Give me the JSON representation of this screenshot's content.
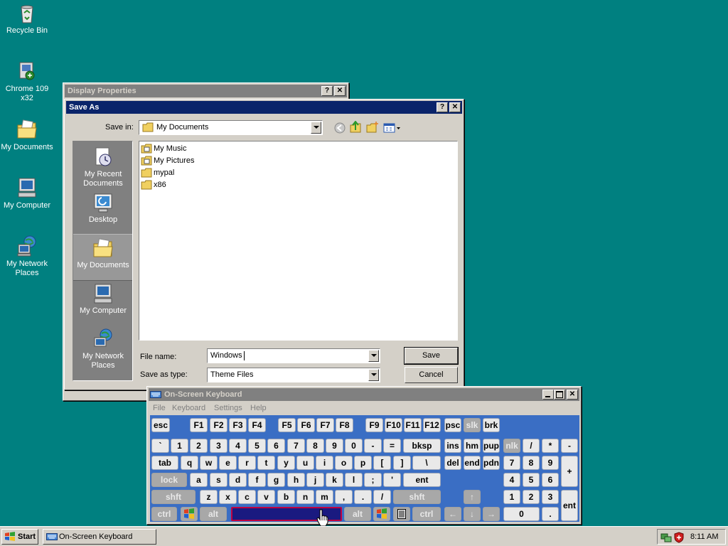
{
  "desktop": {
    "icons": [
      {
        "label": "Recycle Bin",
        "icon": "recycle-bin-icon"
      },
      {
        "label": "Chrome 109 x32",
        "icon": "chrome-setup-icon"
      },
      {
        "label": "My Documents",
        "icon": "my-documents-icon"
      },
      {
        "label": "My Computer",
        "icon": "my-computer-icon"
      },
      {
        "label": "My Network Places",
        "icon": "network-places-icon"
      }
    ]
  },
  "display_properties": {
    "title": "Display Properties",
    "help": "?",
    "close": "✕"
  },
  "save_as": {
    "title": "Save As",
    "help": "?",
    "close": "✕",
    "save_in_label": "Save in:",
    "save_in_value": "My Documents",
    "places": [
      {
        "label": "My Recent Documents",
        "icon": "recent-documents-icon"
      },
      {
        "label": "Desktop",
        "icon": "desktop-icon"
      },
      {
        "label": "My Documents",
        "icon": "my-documents-icon"
      },
      {
        "label": "My Computer",
        "icon": "my-computer-icon"
      },
      {
        "label": "My Network Places",
        "icon": "network-places-icon"
      }
    ],
    "files": [
      {
        "name": "My Music",
        "icon": "special-folder-icon"
      },
      {
        "name": "My Pictures",
        "icon": "special-folder-icon"
      },
      {
        "name": "mypal",
        "icon": "folder-icon"
      },
      {
        "name": "x86",
        "icon": "folder-icon"
      }
    ],
    "file_name_label": "File name:",
    "file_name_value": "Windows",
    "save_type_label": "Save as type:",
    "save_type_value": "Theme Files",
    "save_button": "Save",
    "cancel_button": "Cancel"
  },
  "osk": {
    "title": "On-Screen Keyboard",
    "menu": [
      "File",
      "Keyboard",
      "Settings",
      "Help"
    ],
    "keys": {
      "esc": "esc",
      "f1": "F1",
      "f2": "F2",
      "f3": "F3",
      "f4": "F4",
      "f5": "F5",
      "f6": "F6",
      "f7": "F7",
      "f8": "F8",
      "f9": "F9",
      "f10": "F10",
      "f11": "F11",
      "f12": "F12",
      "psc": "psc",
      "slk": "slk",
      "brk": "brk",
      "row1": [
        "`",
        "1",
        "2",
        "3",
        "4",
        "5",
        "6",
        "7",
        "8",
        "9",
        "0",
        "-",
        "="
      ],
      "bksp": "bksp",
      "ins": "ins",
      "hm": "hm",
      "pup": "pup",
      "nlk": "nlk",
      "np_div": "/",
      "np_mul": "*",
      "np_sub": "-",
      "tab": "tab",
      "row2": [
        "q",
        "w",
        "e",
        "r",
        "t",
        "y",
        "u",
        "i",
        "o",
        "p",
        "[",
        "]",
        "\\"
      ],
      "del": "del",
      "end": "end",
      "pdn": "pdn",
      "np7": "7",
      "np8": "8",
      "np9": "9",
      "np_add": "+",
      "lock": "lock",
      "row3": [
        "a",
        "s",
        "d",
        "f",
        "g",
        "h",
        "j",
        "k",
        "l",
        ";",
        "'"
      ],
      "ent": "ent",
      "np4": "4",
      "np5": "5",
      "np6": "6",
      "lshft": "shft",
      "row4": [
        "z",
        "x",
        "c",
        "v",
        "b",
        "n",
        "m",
        ",",
        ".",
        "/"
      ],
      "rshft": "shft",
      "up": "↑",
      "np1": "1",
      "np2": "2",
      "np3": "3",
      "np_ent": "ent",
      "lctrl": "ctrl",
      "lalt": "alt",
      "ralt": "alt",
      "rctrl": "ctrl",
      "left": "←",
      "down": "↓",
      "right": "→",
      "np0": "0",
      "np_dot": "."
    }
  },
  "taskbar": {
    "start": "Start",
    "task": "On-Screen Keyboard",
    "clock": "8:11 AM"
  },
  "colors": {
    "desktop": "#008080",
    "active_title": "#0a246a",
    "inactive_title": "#808080",
    "osk_body": "#3a6ec4",
    "space_key": "#1a1a80"
  }
}
